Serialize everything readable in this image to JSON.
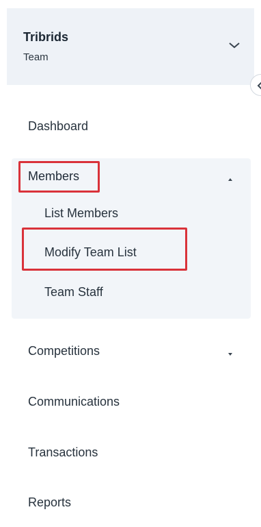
{
  "team": {
    "name": "Tribrids",
    "type": "Team"
  },
  "nav": {
    "dashboard": "Dashboard",
    "members": "Members",
    "members_sub": [
      "List Members",
      "Modify Team List",
      "Team Staff"
    ],
    "competitions": "Competitions",
    "communications": "Communications",
    "transactions": "Transactions",
    "reports": "Reports"
  },
  "icons": {
    "team_switcher": "chevron-down-icon",
    "collapse": "chevron-left-icon",
    "members_expanded": "caret-up-icon",
    "competitions_collapsed": "caret-down-icon"
  },
  "colors": {
    "highlight": "#d9323a",
    "panel": "#eef2f7",
    "submenu": "#f2f5f9"
  }
}
